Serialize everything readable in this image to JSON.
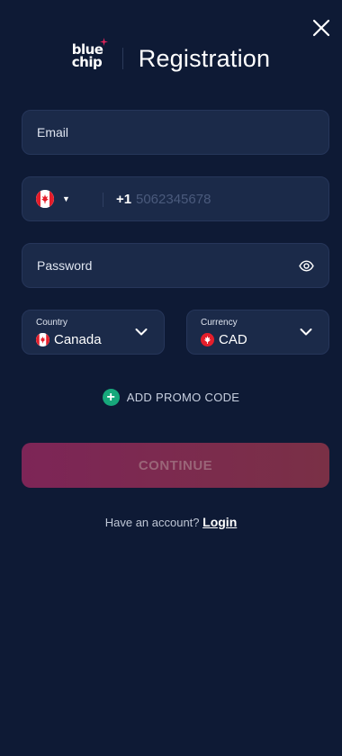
{
  "header": {
    "logo_line1": "blue",
    "logo_line2": "chip",
    "title": "Registration",
    "close_icon": "close-icon"
  },
  "form": {
    "email_label": "Email",
    "phone": {
      "country_flag": "canada-flag-icon",
      "dial_code": "+1",
      "placeholder": "5062345678"
    },
    "password_label": "Password",
    "password_icon": "eye-icon",
    "country": {
      "label": "Country",
      "value": "Canada"
    },
    "currency": {
      "label": "Currency",
      "value": "CAD"
    },
    "promo_label": "ADD PROMO CODE",
    "continue_label": "CONTINUE"
  },
  "footer": {
    "have_account_text": "Have an account?",
    "login_label": "Login"
  },
  "colors": {
    "background": "#0e1a35",
    "field_bg": "#1b2a49",
    "promo_accent": "#17a87b",
    "continue_start": "#7d2557",
    "continue_end": "#7a3046"
  }
}
